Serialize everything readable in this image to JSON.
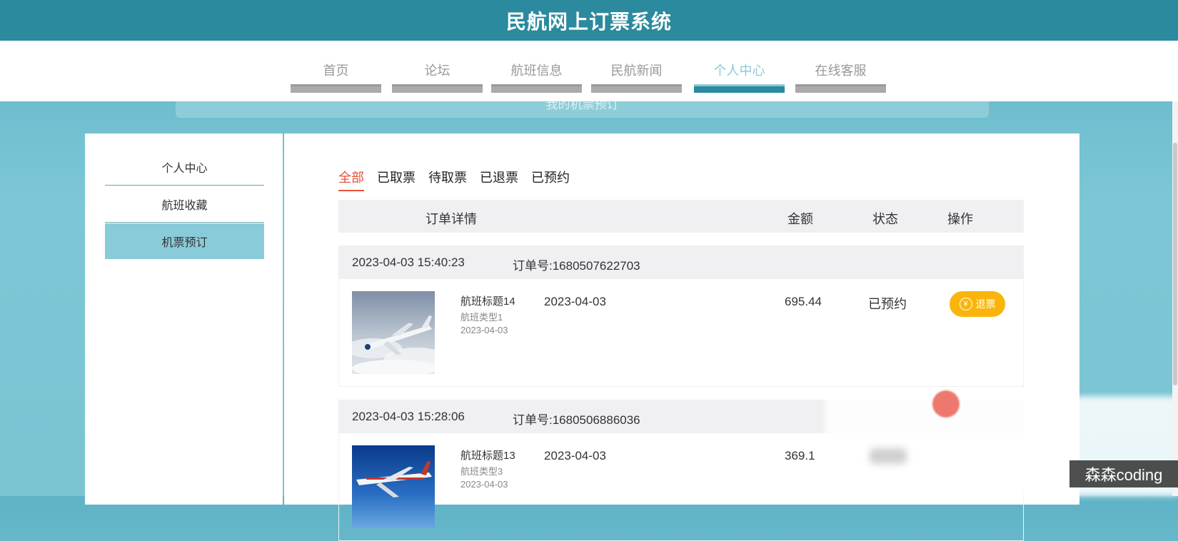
{
  "app": {
    "title": "民航网上订票系统"
  },
  "nav": {
    "items": [
      {
        "label": "首页"
      },
      {
        "label": "论坛"
      },
      {
        "label": "航班信息"
      },
      {
        "label": "民航新闻"
      },
      {
        "label": "个人中心"
      },
      {
        "label": "在线客服"
      }
    ],
    "active_index": 4
  },
  "banner": {
    "text": "我的机票预订"
  },
  "sidebar": {
    "items": [
      {
        "label": "个人中心"
      },
      {
        "label": "航班收藏"
      },
      {
        "label": "机票预订"
      }
    ],
    "active_index": 2
  },
  "tabs": [
    {
      "label": "全部"
    },
    {
      "label": "已取票"
    },
    {
      "label": "待取票"
    },
    {
      "label": "已退票"
    },
    {
      "label": "已预约"
    }
  ],
  "table": {
    "headers": {
      "detail": "订单详情",
      "amount": "金额",
      "status": "状态",
      "action": "操作"
    }
  },
  "orders": [
    {
      "time": "2023-04-03 15:40:23",
      "order_no": "订单号:1680507622703",
      "flight_title": "航班标题14",
      "flight_type": "航班类型1",
      "flight_date": "2023-04-03",
      "date": "2023-04-03",
      "amount": "695.44",
      "status": "已预约",
      "action": "退票"
    },
    {
      "time": "2023-04-03 15:28:06",
      "order_no": "订单号:1680506886036",
      "flight_title": "航班标题13",
      "flight_type": "航班类型3",
      "flight_date": "2023-04-03",
      "date": "2023-04-03",
      "amount": "369.1",
      "status": "",
      "action": ""
    }
  ],
  "watermark": "森森coding",
  "colors": {
    "header": "#2b8a9d",
    "accent_tab": "#e7503a",
    "refund_button": "#f9b50b",
    "sidebar_active": "#8acbda"
  }
}
